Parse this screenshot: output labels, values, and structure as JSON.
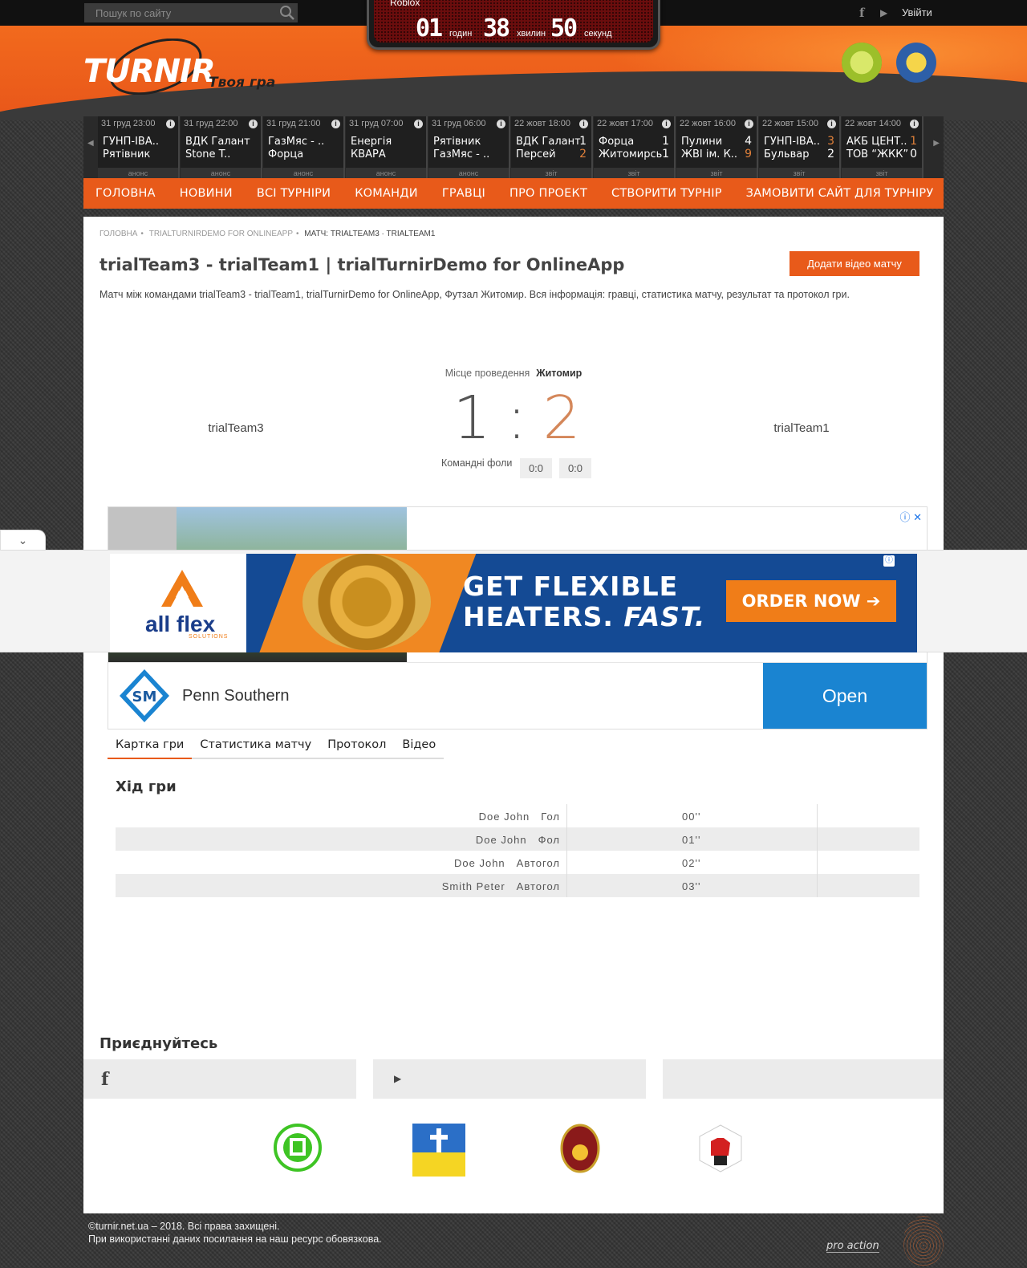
{
  "topbar": {
    "search_placeholder": "Пошук по сайту",
    "login": "Увійти"
  },
  "countdown": {
    "title": "Roblox",
    "hours": "01",
    "hours_label": "годин",
    "minutes": "38",
    "minutes_label": "хвилин",
    "seconds": "50",
    "seconds_label": "секунд"
  },
  "logo": {
    "main": "TURNIR",
    "tagline": "Твоя гра"
  },
  "matches": [
    {
      "date": "31 груд 23:00",
      "home": "ГУНП-ІВА..",
      "away": "Рятівник",
      "home_score": "",
      "away_score": "",
      "status": "анонс"
    },
    {
      "date": "31 груд 22:00",
      "home": "ВДК Галант",
      "away": "Stone T..",
      "home_score": "",
      "away_score": "",
      "status": "анонс"
    },
    {
      "date": "31 груд 21:00",
      "home": "ГазМяс - ..",
      "away": "Форца",
      "home_score": "",
      "away_score": "",
      "status": "анонс"
    },
    {
      "date": "31 груд 07:00",
      "home": "Енергія",
      "away": "КВАРА",
      "home_score": "",
      "away_score": "",
      "status": "анонс"
    },
    {
      "date": "31 груд 06:00",
      "home": "Рятівник",
      "away": "ГазМяс - ..",
      "home_score": "",
      "away_score": "",
      "status": "анонс"
    },
    {
      "date": "22 жовт 18:00",
      "home": "ВДК Галант",
      "away": "Персей",
      "home_score": "1",
      "away_score": "2",
      "status": "звіт",
      "winner": "away"
    },
    {
      "date": "22 жовт 17:00",
      "home": "Форца",
      "away": "Житомирсь",
      "home_score": "1",
      "away_score": "1",
      "status": "звіт",
      "winner": ""
    },
    {
      "date": "22 жовт 16:00",
      "home": "Пулини",
      "away": "ЖВІ ім. К..",
      "home_score": "4",
      "away_score": "9",
      "status": "звіт",
      "winner": "away"
    },
    {
      "date": "22 жовт 15:00",
      "home": "ГУНП-ІВА..",
      "away": "Бульвар",
      "home_score": "3",
      "away_score": "2",
      "status": "звіт",
      "winner": "home"
    },
    {
      "date": "22 жовт 14:00",
      "home": "АКБ ЦЕНТ..",
      "away": "ТОВ “ЖКК”",
      "home_score": "1",
      "away_score": "0",
      "status": "звіт",
      "winner": "home"
    }
  ],
  "nav": [
    "ГОЛОВНА",
    "НОВИНИ",
    "ВСІ ТУРНІРИ",
    "КОМАНДИ",
    "ГРАВЦІ",
    "ПРО ПРОЕКТ",
    "СТВОРИТИ ТУРНІР",
    "ЗАМОВИТИ САЙТ ДЛЯ ТУРНІРУ"
  ],
  "breadcrumbs": [
    "ГОЛОВНА",
    "TRIALTURNIRDEMO FOR ONLINEAPP",
    "МАТЧ: TRIALTEAM3 · TRIALTEAM1"
  ],
  "page": {
    "title": "trialTeam3 - trialTeam1 | trialTurnirDemo for OnlineApp",
    "video_button": "Додати відео матчу",
    "description": "Матч між командами trialTeam3 - trialTeam1, trialTurnirDemo for OnlineApp, Футзал Житомир. Вся інформація: гравці, статистика матчу, результат та протокол гри."
  },
  "match": {
    "venue_label": "Місце проведення",
    "venue": "Житомир",
    "home_team": "trialTeam3",
    "away_team": "trialTeam1",
    "home_score": "1",
    "away_score": "2",
    "separator": ":",
    "fouls_label": "Командні фоли",
    "home_fouls": "0:0",
    "away_fouls": "0:0"
  },
  "ad": {
    "advertiser": "Penn Southern",
    "cta": "Open",
    "banner_brand": "all flex",
    "banner_brand_sub": "SOLUTIONS",
    "banner_line1": "GET FLEXIBLE",
    "banner_line2_a": "HEATERS.",
    "banner_line2_b": "FAST.",
    "banner_cta": "ORDER NOW ➔"
  },
  "tabs": [
    "Картка гри",
    "Статистика матчу",
    "Протокол",
    "Відео"
  ],
  "events_heading": "Хід гри",
  "events": [
    {
      "player": "Doe John",
      "type": "Гол",
      "time": "00''"
    },
    {
      "player": "Doe John",
      "type": "Фол",
      "time": "01''"
    },
    {
      "player": "Doe John",
      "type": "Автогол",
      "time": "02''"
    },
    {
      "player": "Smith Peter",
      "type": "Автогол",
      "time": "03''"
    }
  ],
  "join_heading": "Приєднуйтесь",
  "footer": {
    "copyright": "©turnir.net.ua – 2018. Всі права захищені.",
    "notice": "При використанні даних посилання на наш ресурс обовязкова.",
    "credit": "pro action"
  },
  "colors": {
    "accent": "#e85a1a",
    "win": "#e0803a",
    "ad_blue": "#1a84d1"
  }
}
